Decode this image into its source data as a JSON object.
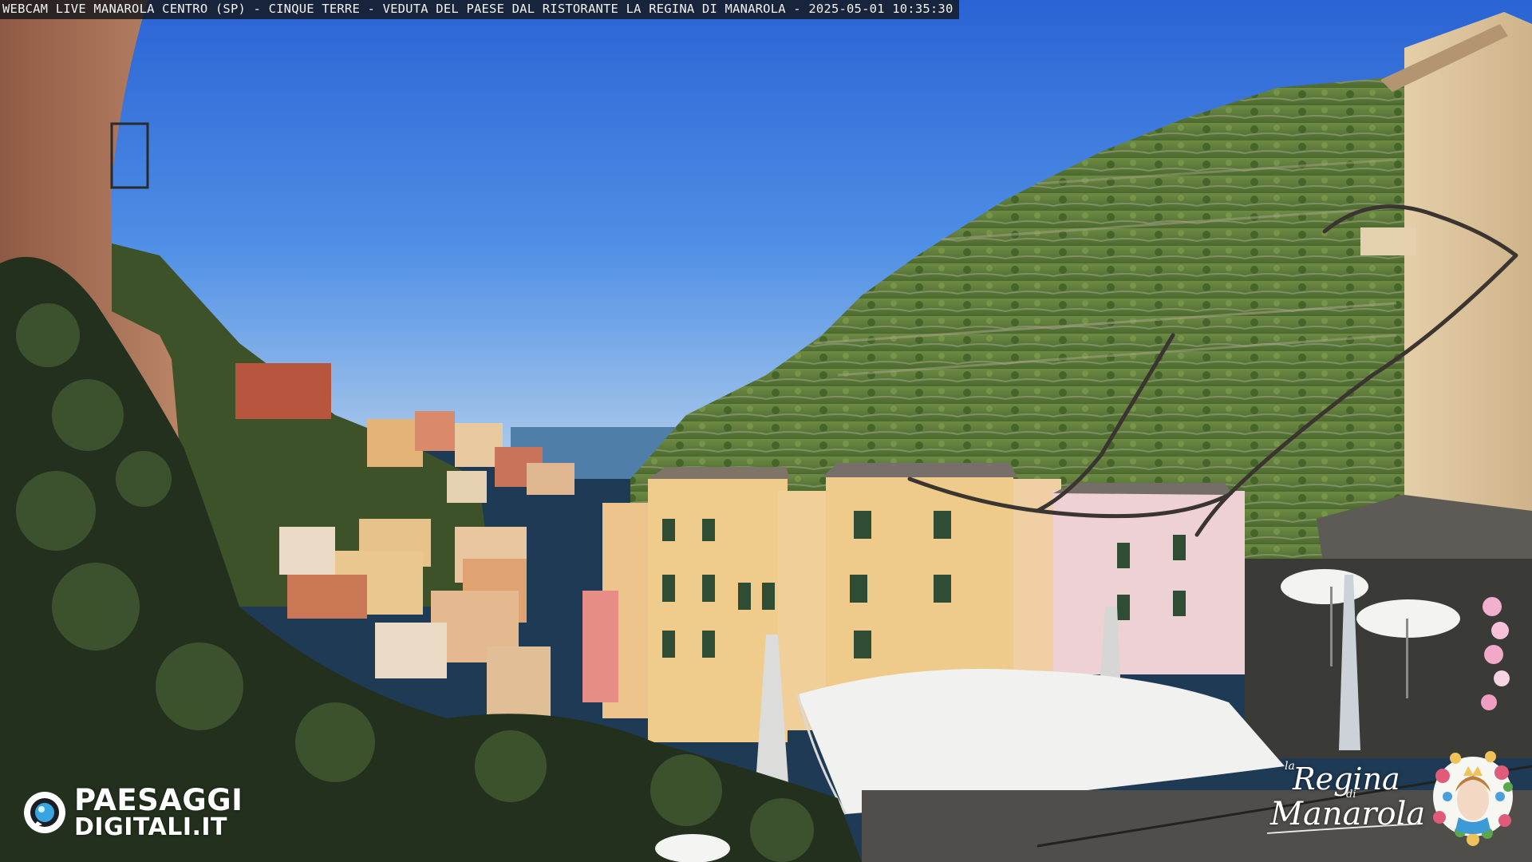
{
  "overlay": {
    "caption": "WEBCAM LIVE MANAROLA CENTRO (SP) - CINQUE TERRE - VEDUTA DEL PAESE DAL RISTORANTE LA REGINA DI MANAROLA - 2025-05-01 10:35:30"
  },
  "brand_left": {
    "line1": "PAESAGGI",
    "line2": "DIGITALI.IT",
    "icon": "camera-lens-icon"
  },
  "brand_right": {
    "word_la": "la",
    "word_regina": "Regina",
    "word_di": "di",
    "word_manarola": "Manarola",
    "icon": "queen-portrait-icon"
  },
  "colors": {
    "sky_top": "#2b66d6",
    "sky_horizon": "#9fc4ec",
    "sea": "#4f7fa8",
    "hillside": "#5f7d3c",
    "foliage": "#2b3a22",
    "building_yellow": "#e9c98d",
    "building_pink": "#eccfcf",
    "umbrella_white": "#f1f1ef",
    "caption_bar": "#14161a",
    "brand_blue": "#37a6e0"
  }
}
